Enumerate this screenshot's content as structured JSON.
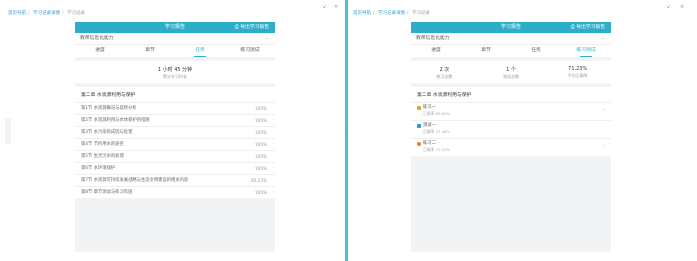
{
  "left": {
    "breadcrumb": [
      "首页导航",
      "学习记录详情",
      "学习记录"
    ],
    "window_controls": [
      "↙",
      "×"
    ],
    "panel": {
      "title": "学习报告",
      "action": "导出学习报告",
      "select": "教师信息化能力",
      "tabs": [
        "进度",
        "章节",
        "任务",
        "练习测试"
      ],
      "active_tab": 2,
      "summary_main": "1 小时 45 分钟",
      "summary_sub": "累计学习时长",
      "chapter_title": "第二章  水资源利用与保护",
      "rows": [
        {
          "label": "第1节 水资源概况与现状分析",
          "pct": "100%"
        },
        {
          "label": "第2节 水资源利用与水体保护的措施",
          "pct": "100%"
        },
        {
          "label": "第3节 水污染的成因与危害",
          "pct": "100%"
        },
        {
          "label": "第4节 节约用水的途径",
          "pct": "100%"
        },
        {
          "label": "第5节 生活污水的处理",
          "pct": "100%"
        },
        {
          "label": "第6节 水环境保护",
          "pct": "100%"
        },
        {
          "label": "第7节 水资源可持续发展战略与生态文明建设的相关内容",
          "pct": "85.23%"
        },
        {
          "label": "第8节 章节测试与练习巩固",
          "pct": "100%"
        }
      ]
    }
  },
  "right": {
    "breadcrumb": [
      "首页导航",
      "学习记录详情",
      "学习记录"
    ],
    "window_controls": [
      "↙",
      "×"
    ],
    "panel": {
      "title": "学习报告",
      "action": "导出学习报告",
      "select": "教师信息化能力",
      "tabs": [
        "进度",
        "章节",
        "任务",
        "练习测试"
      ],
      "active_tab": 3,
      "stats": [
        {
          "value": "2 次",
          "label": "练习次数"
        },
        {
          "value": "1 个",
          "label": "测试次数"
        },
        {
          "value": "71.23%",
          "label": "平均正确率"
        }
      ],
      "chapter_title": "第二章  水资源利用与保护",
      "rows": [
        {
          "name": "练习一",
          "sub": "正确率 85.00%",
          "icon_color": "#f0a030"
        },
        {
          "name": "测试一",
          "sub": "正确率 57.46%",
          "icon_color": "#2a9bd8"
        },
        {
          "name": "练习二",
          "sub": "正确率 71.23%",
          "icon_color": "#f07830"
        }
      ]
    }
  },
  "colors": {
    "accent": "#2aaec9",
    "link": "#2a9bd8",
    "divider": "#4ac0d8"
  }
}
